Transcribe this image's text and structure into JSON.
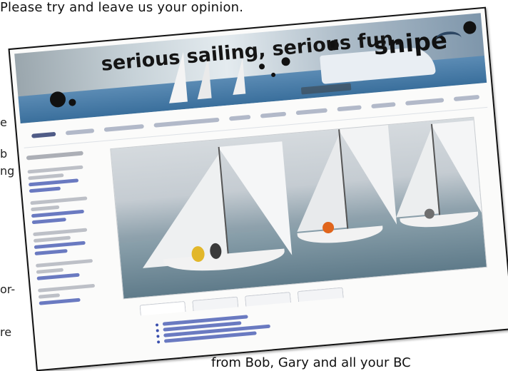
{
  "page": {
    "top_line": "Please try and leave us your opinion.",
    "side_fragments": [
      "e",
      "b",
      "ng",
      "or-",
      "re"
    ],
    "bottom_line": "from Bob, Gary and all your BC"
  },
  "photo": {
    "banner": {
      "slogan": "serious sailing, serious fun.",
      "logo": "snipe"
    }
  }
}
